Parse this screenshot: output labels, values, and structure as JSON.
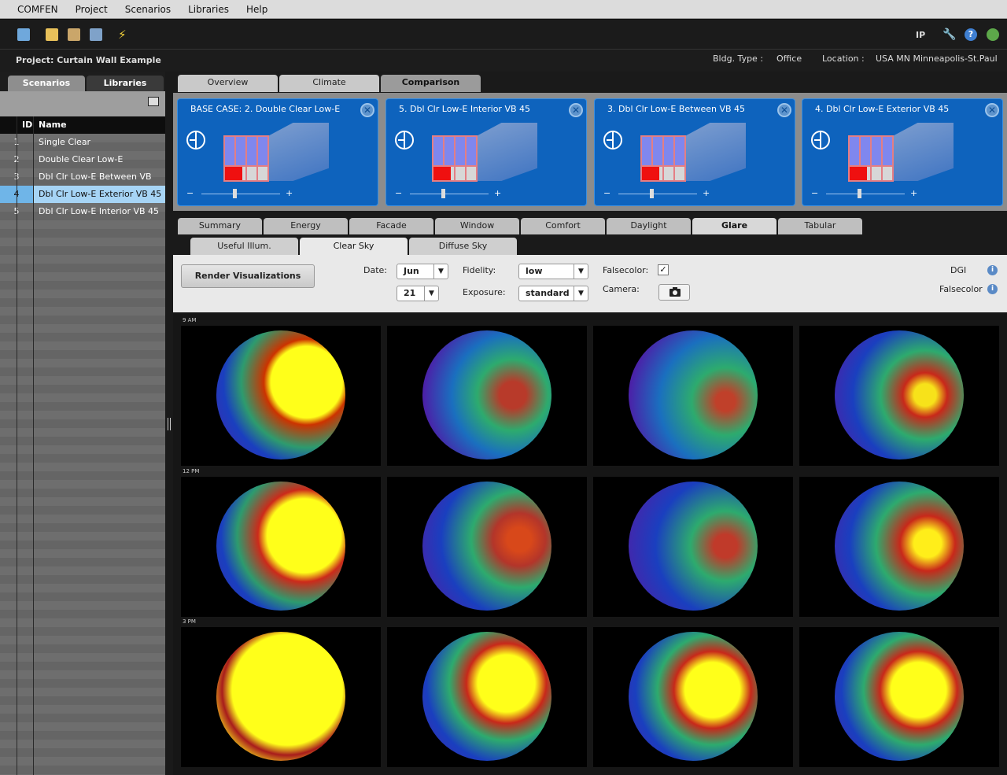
{
  "menu": [
    "COMFEN",
    "Project",
    "Scenarios",
    "Libraries",
    "Help"
  ],
  "toolbar": {
    "units": "IP"
  },
  "project": {
    "label": "Project: Curtain Wall Example",
    "bldg_type_label": "Bldg. Type :",
    "bldg_type": "Office",
    "location_label": "Location :",
    "location": "USA MN Minneapolis-St.Paul"
  },
  "left_tabs": [
    "Scenarios",
    "Libraries"
  ],
  "table": {
    "headers": {
      "id": "ID",
      "name": "Name"
    },
    "rows": [
      {
        "id": "1",
        "name": "Single Clear"
      },
      {
        "id": "2",
        "name": "Double Clear Low-E"
      },
      {
        "id": "3",
        "name": "Dbl Clr Low-E Between VB 45"
      },
      {
        "id": "4",
        "name": "Dbl Clr Low-E Exterior VB 45"
      },
      {
        "id": "5",
        "name": "Dbl Clr Low-E Interior VB 45"
      }
    ]
  },
  "top_tabs": [
    "Overview",
    "Climate",
    "Comparison"
  ],
  "cards": [
    {
      "title": "BASE CASE: 2. Double Clear Low-E"
    },
    {
      "title": "5. Dbl Clr Low-E Interior VB 45"
    },
    {
      "title": "3. Dbl Clr Low-E Between VB 45"
    },
    {
      "title": "4. Dbl Clr Low-E Exterior VB 45"
    }
  ],
  "card_controls": {
    "minus": "−",
    "plus": "+",
    "close": "✕"
  },
  "result_tabs": [
    "Summary",
    "Energy",
    "Facade",
    "Window",
    "Comfort",
    "Daylight",
    "Glare",
    "Tabular"
  ],
  "glare_tabs": [
    "Useful Illum.",
    "Clear Sky",
    "Diffuse Sky"
  ],
  "controls": {
    "render_button": "Render Visualizations",
    "date_label": "Date:",
    "month": "Jun",
    "day": "21",
    "fidelity_label": "Fidelity:",
    "fidelity": "low",
    "exposure_label": "Exposure:",
    "exposure": "standard",
    "falsecolor_label": "Falsecolor:",
    "falsecolor_checked": "✓",
    "camera_label": "Camera:",
    "dgi_label": "DGI",
    "falsecolor_info_label": "Falsecolor",
    "info": "i",
    "arrow": "▼"
  },
  "time_rows": [
    "9 AM",
    "12 PM",
    "3 PM"
  ]
}
